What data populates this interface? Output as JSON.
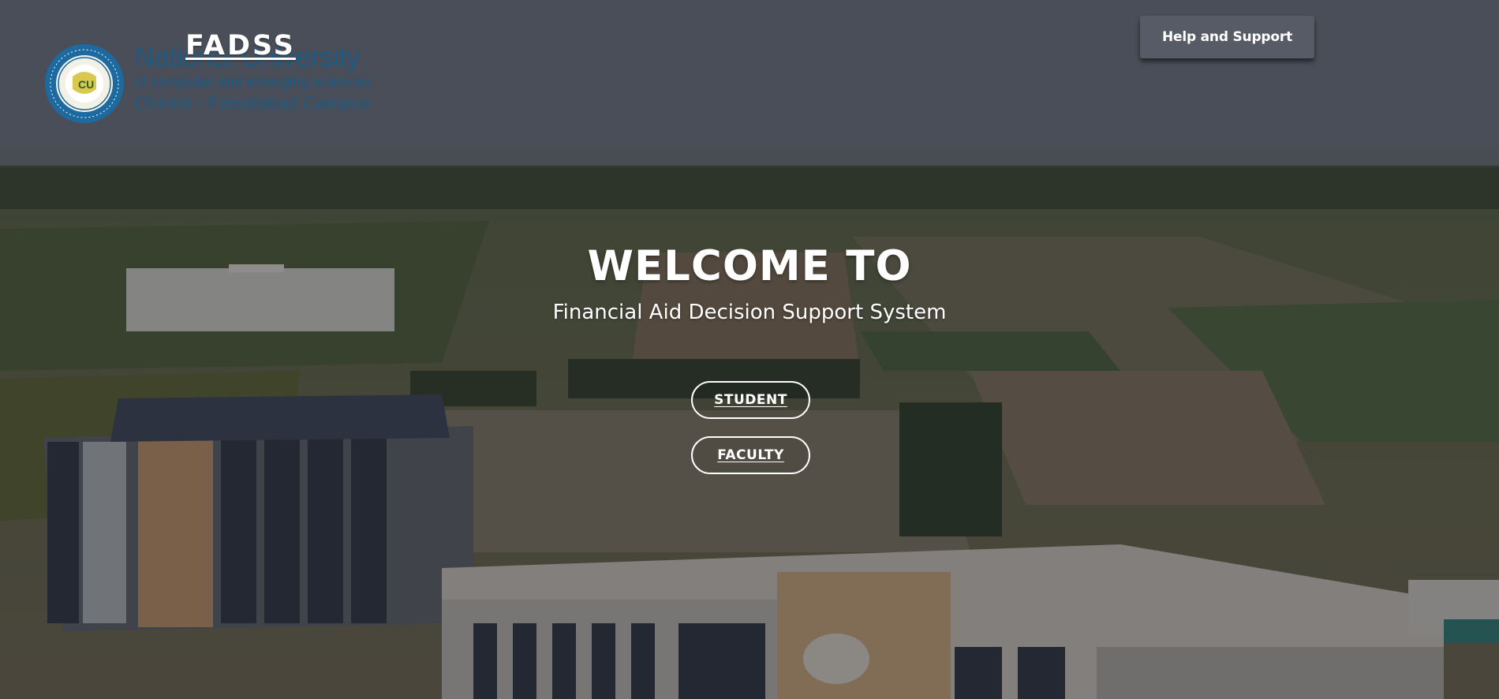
{
  "header": {
    "brand": "FADSS",
    "help_label": "Help and Support",
    "logo": {
      "line1": "National University",
      "line2": "of computer and emerging sciences",
      "line3": "Chiniot - Faisalabad Campus"
    }
  },
  "hero": {
    "title": "WELCOME TO",
    "subtitle": "Financial Aid Decision Support System"
  },
  "buttons": {
    "student": "STUDENT",
    "faculty": "FACULTY"
  },
  "colors": {
    "header_band": "#4a4e58",
    "help_button": "#565b65",
    "logo_blue": "#1e5b82",
    "text": "#ffffff"
  }
}
